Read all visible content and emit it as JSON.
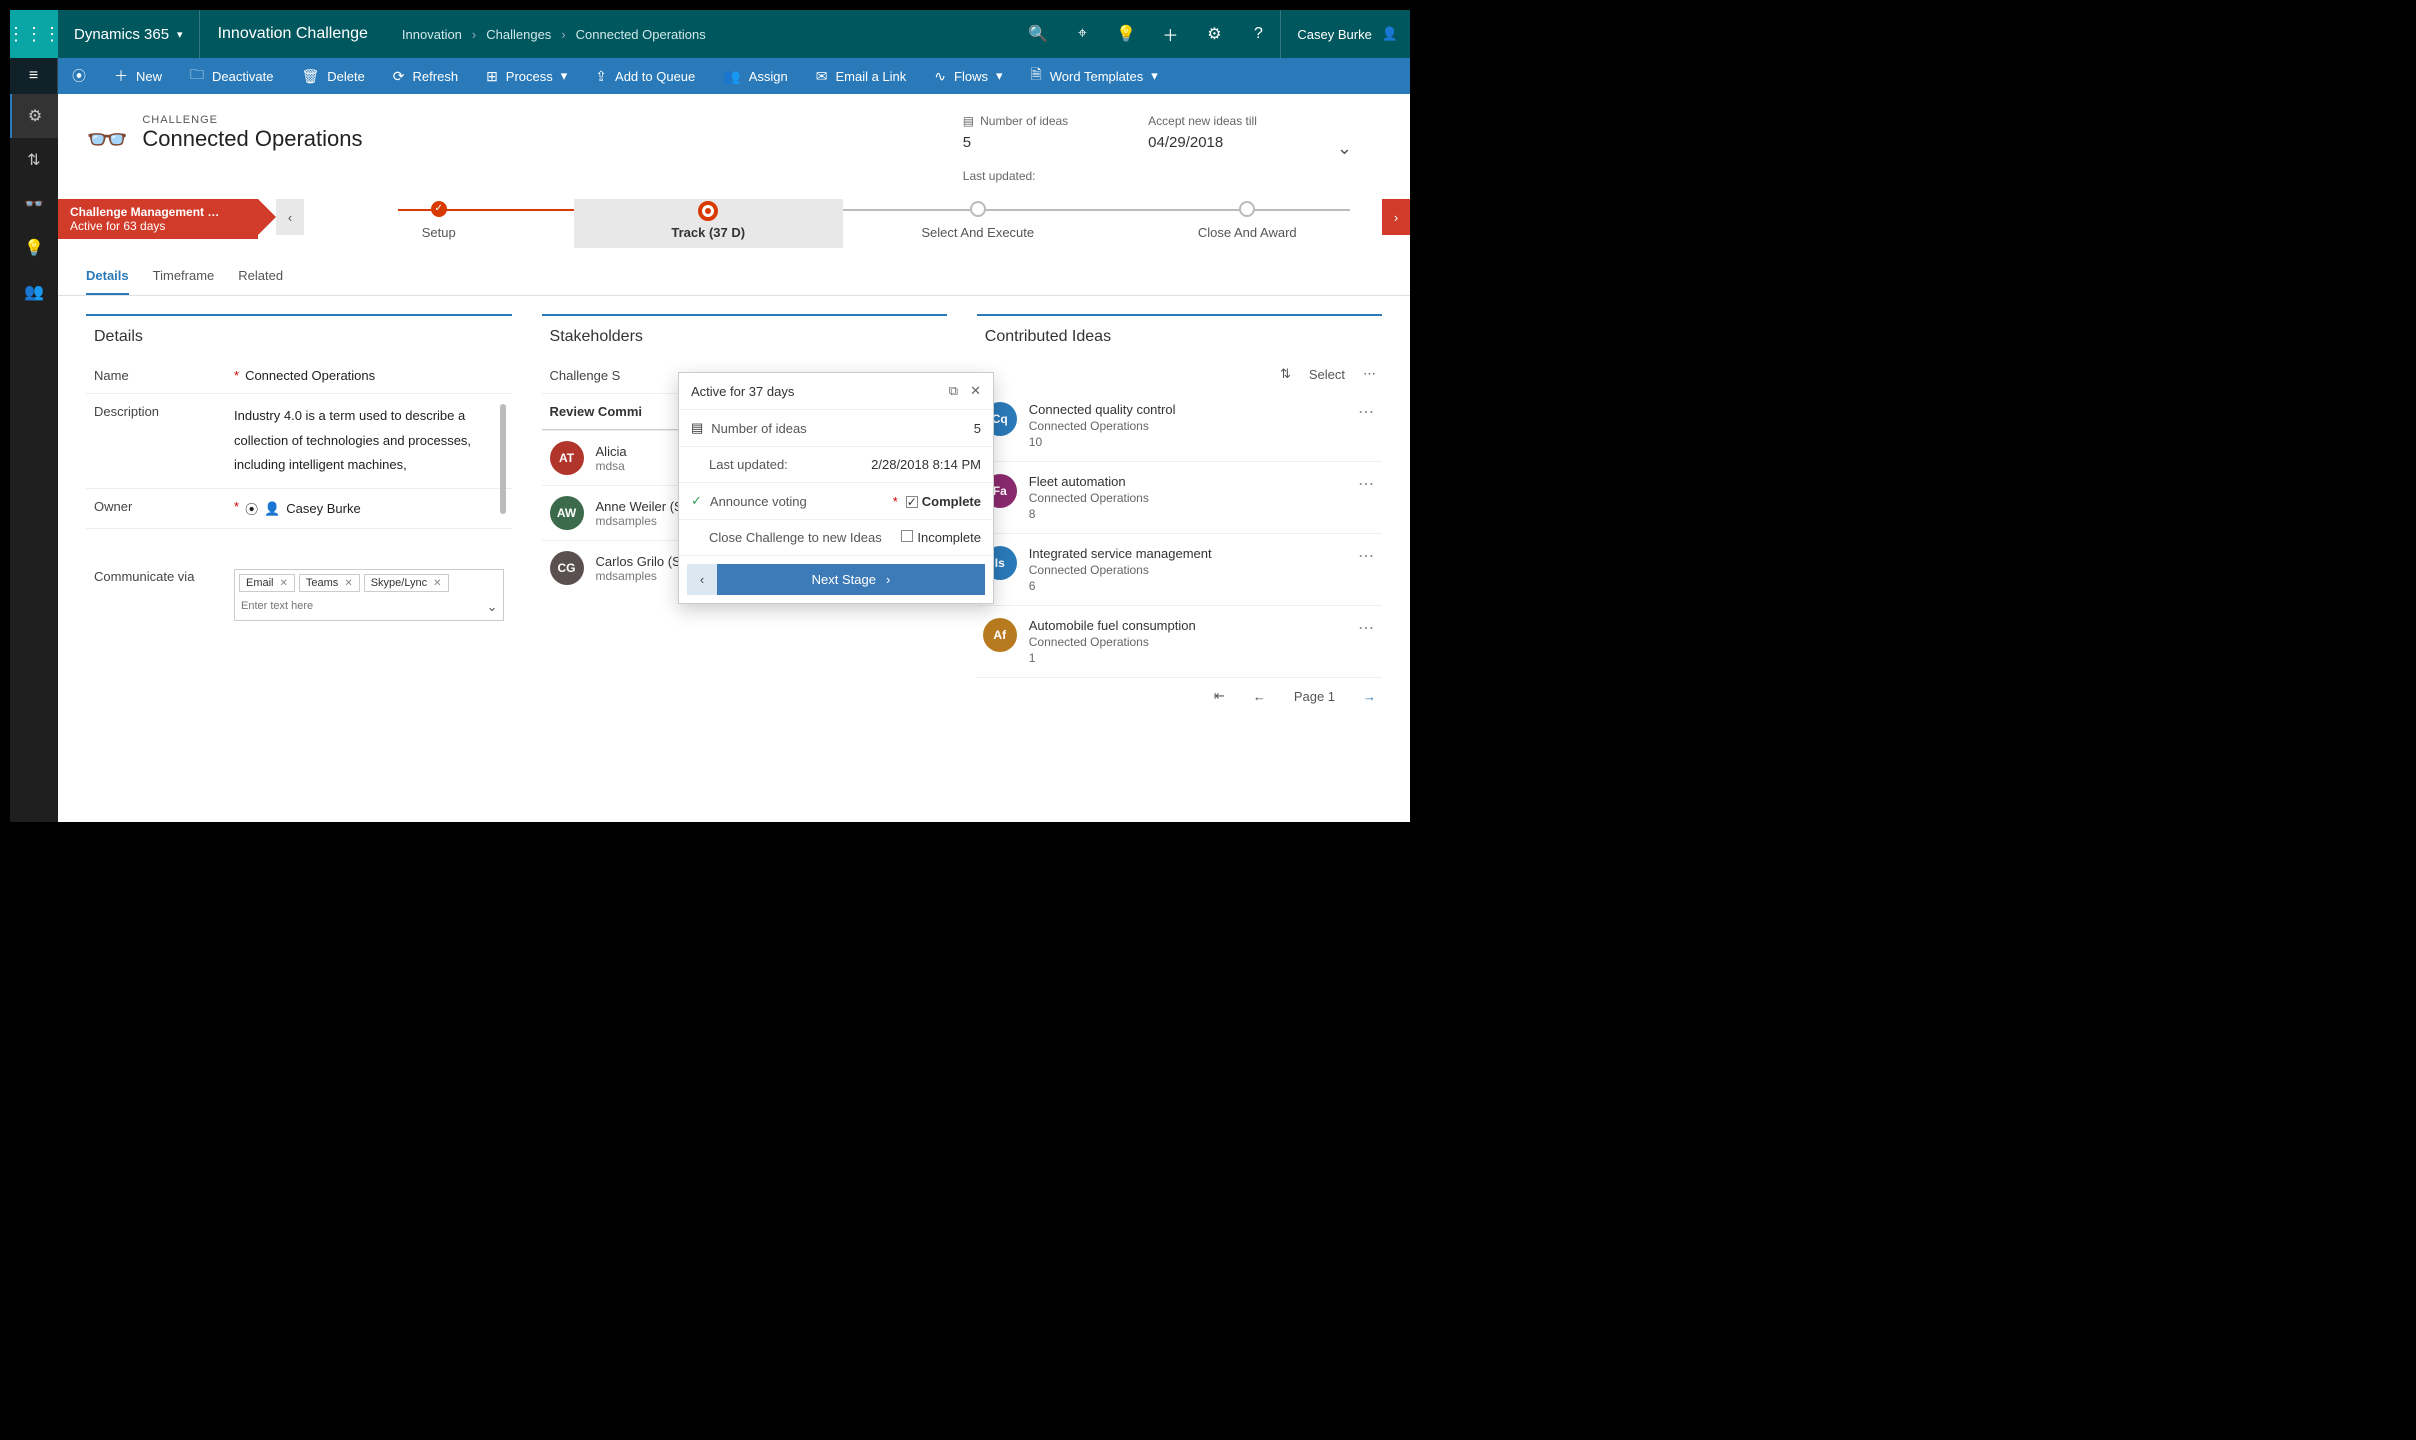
{
  "top": {
    "brand": "Dynamics 365",
    "app": "Innovation Challenge",
    "crumbs": [
      "Innovation",
      "Challenges",
      "Connected Operations"
    ],
    "user": "Casey Burke"
  },
  "cmds": {
    "new": "New",
    "deactivate": "Deactivate",
    "delete": "Delete",
    "refresh": "Refresh",
    "process": "Process",
    "queue": "Add to Queue",
    "assign": "Assign",
    "email": "Email a Link",
    "flows": "Flows",
    "word": "Word Templates"
  },
  "record": {
    "entity": "CHALLENGE",
    "name": "Connected Operations",
    "ideas_label": "Number of ideas",
    "ideas": "5",
    "accept_label": "Accept new ideas till",
    "accept": "04/29/2018",
    "updated_label": "Last updated:"
  },
  "bpf": {
    "card_title": "Challenge Management …",
    "card_sub": "Active for 63 days",
    "stages": [
      "Setup",
      "Track  (37 D)",
      "Select And Execute",
      "Close And Award"
    ]
  },
  "tabs": [
    "Details",
    "Timeframe",
    "Related"
  ],
  "details": {
    "heading": "Details",
    "name_label": "Name",
    "name_value": "Connected Operations",
    "desc_label": "Description",
    "desc_value": "Industry 4.0 is a term used to describe a collection of technologies and processes, including intelligent machines,",
    "owner_label": "Owner",
    "owner_value": "Casey Burke",
    "comm_label": "Communicate via",
    "chips": [
      "Email",
      "Teams",
      "Skype/Lync"
    ],
    "placeholder": "Enter text here"
  },
  "stake": {
    "heading": "Stakeholders",
    "sponsor": "Challenge S",
    "review": "Review Commi",
    "people": [
      {
        "initials": "AT",
        "name": "Alicia",
        "sub": "mdsa",
        "color": "#b1352a"
      },
      {
        "initials": "AW",
        "name": "Anne Weiler (Sample Data)",
        "sub": "mdsamples",
        "color": "#3b6b4a"
      },
      {
        "initials": "CG",
        "name": "Carlos Grilo (Sample Data)",
        "sub": "mdsamples",
        "color": "#5b5050"
      }
    ]
  },
  "ideas": {
    "heading": "Contributed Ideas",
    "select": "Select",
    "items": [
      {
        "initials": "Cq",
        "title": "Connected quality control",
        "sub": "Connected Operations",
        "count": "10",
        "color": "#2a7ab9"
      },
      {
        "initials": "Fa",
        "title": "Fleet automation",
        "sub": "Connected Operations",
        "count": "8",
        "color": "#8a2a6f"
      },
      {
        "initials": "Is",
        "title": "Integrated service management",
        "sub": "Connected Operations",
        "count": "6",
        "color": "#2a7ab9"
      },
      {
        "initials": "Af",
        "title": "Automobile fuel consumption",
        "sub": "Connected Operations",
        "count": "1",
        "color": "#b77a1f"
      }
    ],
    "page": "Page 1"
  },
  "flyout": {
    "active": "Active for 37 days",
    "ideas_label": "Number of ideas",
    "ideas": "5",
    "updated_label": "Last updated:",
    "updated": "2/28/2018 8:14 PM",
    "announce": "Announce voting",
    "complete": "Complete",
    "close_label": "Close Challenge to new Ideas",
    "incomplete": "Incomplete",
    "next": "Next Stage"
  }
}
